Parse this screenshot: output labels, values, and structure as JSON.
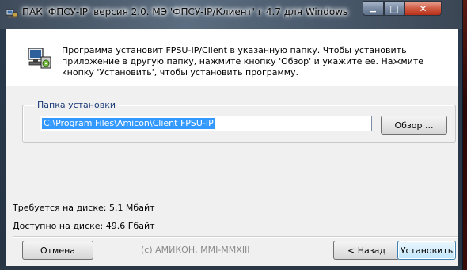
{
  "window": {
    "title": "ПАК 'ФПСУ-IP' версия 2.0. МЭ 'ФПСУ-IP/Клиент' г 4.7 для Windows",
    "minimize_glyph": "▁",
    "maximize_glyph": "□",
    "close_glyph": "✕"
  },
  "header": {
    "info_text": "Программа установит FPSU-IP/Client в указанную папку. Чтобы установить приложение в другую папку, нажмите кнопку 'Обзор' и укажите ее. Нажмите кнопку 'Установить', чтобы установить программу.",
    "icon": "installer-computer-icon"
  },
  "install_folder": {
    "label": "Папка установки",
    "path": "C:\\Program Files\\Amicon\\Client FPSU-IP",
    "browse_label": "Обзор ..."
  },
  "disk": {
    "required": "Требуется на диске: 5.1 Мбайт",
    "available": "Доступно на диске: 49.6 Гбайт"
  },
  "footer": {
    "cancel_label": "Отмена",
    "copyright": "(c) АМИКОН, MMI-MMXIII",
    "back_label": "< Назад",
    "install_label": "Установить"
  },
  "colors": {
    "selection": "#3399ff",
    "group_label": "#1a3a78",
    "close_button": "#d05b43"
  }
}
